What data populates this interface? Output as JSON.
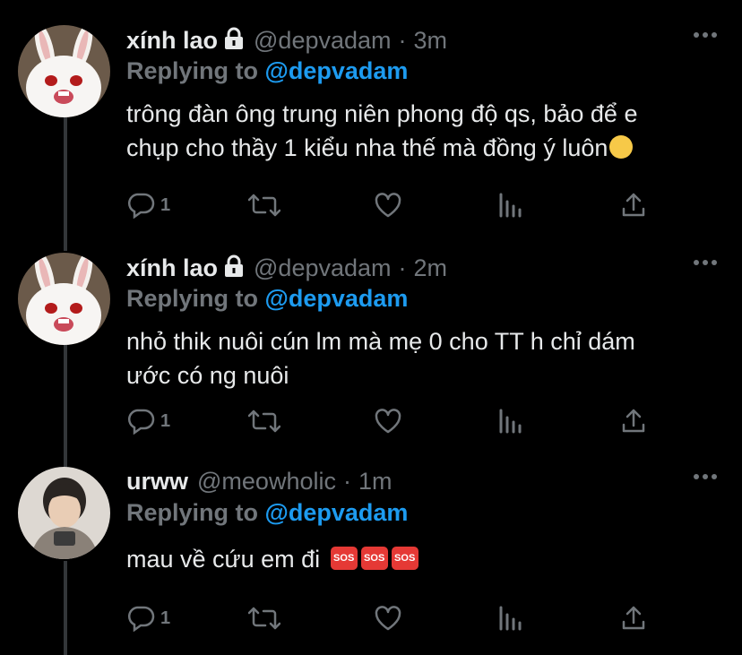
{
  "tweets": [
    {
      "name": "xính lao",
      "handle": "@depvadam",
      "separator": "·",
      "time": "3m",
      "replying_prefix": "Replying to ",
      "replying_to": "@depvadam",
      "text": "trông đàn ông trung niên phong độ qs, bảo để e\nchụp cho thầy 1 kiểu nha thế mà đồng ý luôn",
      "emoji": "relieved-face-emoji",
      "reply_count": "1"
    },
    {
      "name": "xính lao",
      "handle": "@depvadam",
      "separator": "·",
      "time": "2m",
      "replying_prefix": "Replying to ",
      "replying_to": "@depvadam",
      "text": "nhỏ thik nuôi cún lm mà mẹ 0 cho TT h chỉ dám\nước có ng nuôi",
      "reply_count": "1"
    },
    {
      "name": "urww",
      "handle": "@meowholic",
      "separator": "·",
      "time": "1m",
      "replying_prefix": "Replying to ",
      "replying_to": "@depvadam",
      "text": "mau về cứu em đi ",
      "sos_label": "SOS",
      "reply_count": "1"
    }
  ],
  "icons": {
    "more": "more-horizontal-icon",
    "reply": "reply-icon",
    "retweet": "retweet-icon",
    "like": "heart-icon",
    "views": "analytics-icon",
    "share": "share-icon",
    "lock": "lock-icon"
  },
  "colors": {
    "background": "#000000",
    "text": "#e7e9ea",
    "muted": "#71767b",
    "accent": "#1d9bf0",
    "thread_line": "#333639"
  }
}
